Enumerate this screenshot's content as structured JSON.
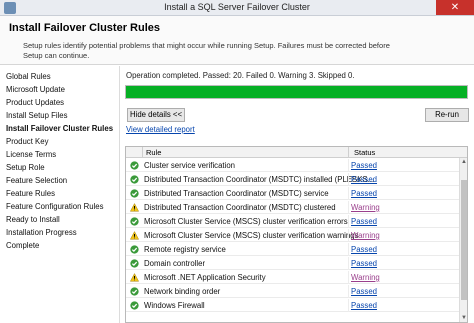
{
  "window": {
    "title": "Install a SQL Server Failover Cluster",
    "close_glyph": "✕"
  },
  "header": {
    "title": "Install Failover Cluster Rules",
    "description": "Setup rules identify potential problems that might occur while running Setup. Failures must be corrected before Setup can continue."
  },
  "sidebar": {
    "items": [
      {
        "label": "Global Rules"
      },
      {
        "label": "Microsoft Update"
      },
      {
        "label": "Product Updates"
      },
      {
        "label": "Install Setup Files"
      },
      {
        "label": "Install Failover Cluster Rules",
        "active": true
      },
      {
        "label": "Product Key"
      },
      {
        "label": "License Terms"
      },
      {
        "label": "Setup Role"
      },
      {
        "label": "Feature Selection"
      },
      {
        "label": "Feature Rules"
      },
      {
        "label": "Feature Configuration Rules"
      },
      {
        "label": "Ready to Install"
      },
      {
        "label": "Installation Progress"
      },
      {
        "label": "Complete"
      }
    ]
  },
  "main": {
    "status": "Operation completed.  Passed: 20.   Failed 0.   Warning 3.   Skipped 0.",
    "progress": 1.0,
    "hide_details": "Hide details <<",
    "rerun": "Re-run",
    "view_report": "View detailed report",
    "columns": {
      "rule": "Rule",
      "status": "Status"
    },
    "rows": [
      {
        "rule": "Cluster service verification",
        "status": "Passed",
        "state": "ok"
      },
      {
        "rule": "Distributed Transaction Coordinator (MSDTC) installed (PLESKS...",
        "status": "Passed",
        "state": "ok"
      },
      {
        "rule": "Distributed Transaction Coordinator (MSDTC) service",
        "status": "Passed",
        "state": "ok"
      },
      {
        "rule": "Distributed Transaction Coordinator (MSDTC) clustered",
        "status": "Warning",
        "state": "warn"
      },
      {
        "rule": "Microsoft Cluster Service (MSCS) cluster verification errors",
        "status": "Passed",
        "state": "ok"
      },
      {
        "rule": "Microsoft Cluster Service (MSCS) cluster verification warnings",
        "status": "Warning",
        "state": "warn"
      },
      {
        "rule": "Remote registry service",
        "status": "Passed",
        "state": "ok"
      },
      {
        "rule": "Domain controller",
        "status": "Passed",
        "state": "ok"
      },
      {
        "rule": "Microsoft .NET Application Security",
        "status": "Warning",
        "state": "warn"
      },
      {
        "rule": "Network binding order",
        "status": "Passed",
        "state": "ok"
      },
      {
        "rule": "Windows Firewall",
        "status": "Passed",
        "state": "ok"
      }
    ]
  },
  "colors": {
    "progress": "#06b025",
    "passed_icon": "#3a9a3a",
    "warning_icon": "#f0c419",
    "link": "#0645ad"
  },
  "icons": {
    "passed": "check-circle-icon",
    "warning": "warning-triangle-icon"
  }
}
